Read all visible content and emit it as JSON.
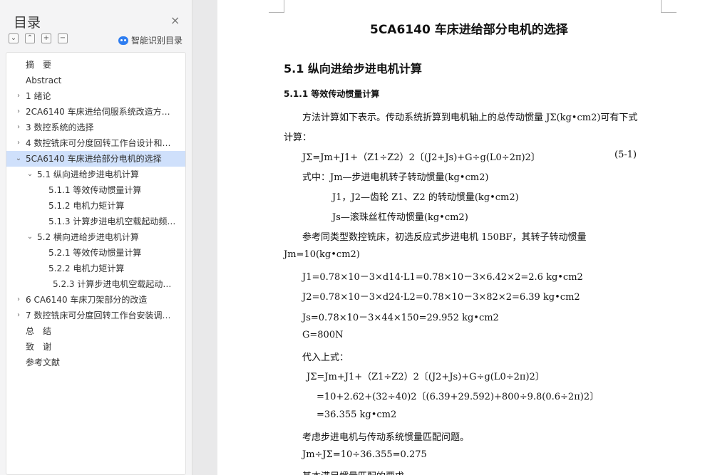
{
  "toc": {
    "title": "目录",
    "close_glyph": "×",
    "tool_buttons": [
      "⌄",
      "⌃",
      "+",
      "−"
    ],
    "smart_label": "智能识别目录",
    "items": [
      {
        "label": "摘　要",
        "level": 0,
        "chevron": ""
      },
      {
        "label": "Abstract",
        "level": 0,
        "chevron": ""
      },
      {
        "label": "1 绪论",
        "level": 0,
        "chevron": "›"
      },
      {
        "label": "2CA6140 车床进给伺服系统改造方…",
        "level": 0,
        "chevron": "›"
      },
      {
        "label": "3 数控系统的选择",
        "level": 0,
        "chevron": "›"
      },
      {
        "label": "4 数控铣床可分度回转工作台设计和…",
        "level": 0,
        "chevron": "›"
      },
      {
        "label": "5CA6140 车床进给部分电机的选择",
        "level": 0,
        "chevron": "⌄",
        "active": true
      },
      {
        "label": "5.1 纵向进给步进电机计算",
        "level": 1,
        "chevron": "⌄"
      },
      {
        "label": "5.1.1 等效传动惯量计算",
        "level": 2,
        "chevron": ""
      },
      {
        "label": "5.1.2 电机力矩计算",
        "level": 2,
        "chevron": ""
      },
      {
        "label": "5.1.3 计算步进电机空载起动频…",
        "level": 2,
        "chevron": ""
      },
      {
        "label": "5.2 横向进给步进电机计算",
        "level": 1,
        "chevron": "⌄"
      },
      {
        "label": "5.2.1 等效传动惯量计算",
        "level": 2,
        "chevron": ""
      },
      {
        "label": "5.2.2 电机力矩计算",
        "level": 2,
        "chevron": ""
      },
      {
        "label": "5.2.3 计算步进电机空载起动…",
        "level": 3,
        "chevron": ""
      },
      {
        "label": "6 CA6140 车床刀架部分的改造",
        "level": 0,
        "chevron": "›"
      },
      {
        "label": "7 数控铣床可分度回转工作台安装调…",
        "level": 0,
        "chevron": "›"
      },
      {
        "label": "总　结",
        "level": 0,
        "chevron": ""
      },
      {
        "label": "致　谢",
        "level": 0,
        "chevron": ""
      },
      {
        "label": "参考文献",
        "level": 0,
        "chevron": ""
      }
    ]
  },
  "document": {
    "title": "5CA6140 车床进给部分电机的选择",
    "section": "5.1 纵向进给步进电机计算",
    "subsection": "5.1.1 等效传动惯量计算",
    "lines": [
      "方法计算如下表示。传动系统折算到电机轴上的总传动惯量 JΣ(kg•cm2)可有下式",
      "计算：",
      "JΣ=Jm+J1+（Z1÷Z2）2〔(J2+Js)+G÷g(L0÷2π)2〕",
      "式中：Jm—步进电机转子转动惯量(kg•cm2)",
      "J1，J2—齿轮 Z1、Z2 的转动惯量(kg•cm2)",
      "Js—滚珠丝杠传动惯量(kg•cm2)",
      "参考同类型数控铣床，初选反应式步进电机 150BF，其转子转动惯量",
      "Jm=10(kg•cm2)",
      "J1=0.78×10－3×d14·L1=0.78×10－3×6.42×2=2.6 kg•cm2",
      "J2=0.78×10－3×d24·L2=0.78×10－3×82×2=6.39 kg•cm2",
      "Js=0.78×10－3×44×150=29.952 kg•cm2",
      "G=800N",
      "代入上式：",
      "JΣ=Jm+J1+（Z1÷Z2）2〔(J2+Js)+G÷g(L0÷2π)2〕",
      "=10+2.62+(32÷40)2〔(6.39+29.592)+800÷9.8(0.6÷2π)2〕",
      "=36.355 kg•cm2",
      "考虑步进电机与传动系统惯量匹配问题。",
      "Jm÷JΣ=10÷36.355=0.275",
      "基本满足惯量匹配的要求。"
    ],
    "equation_number": "(5-1)"
  }
}
